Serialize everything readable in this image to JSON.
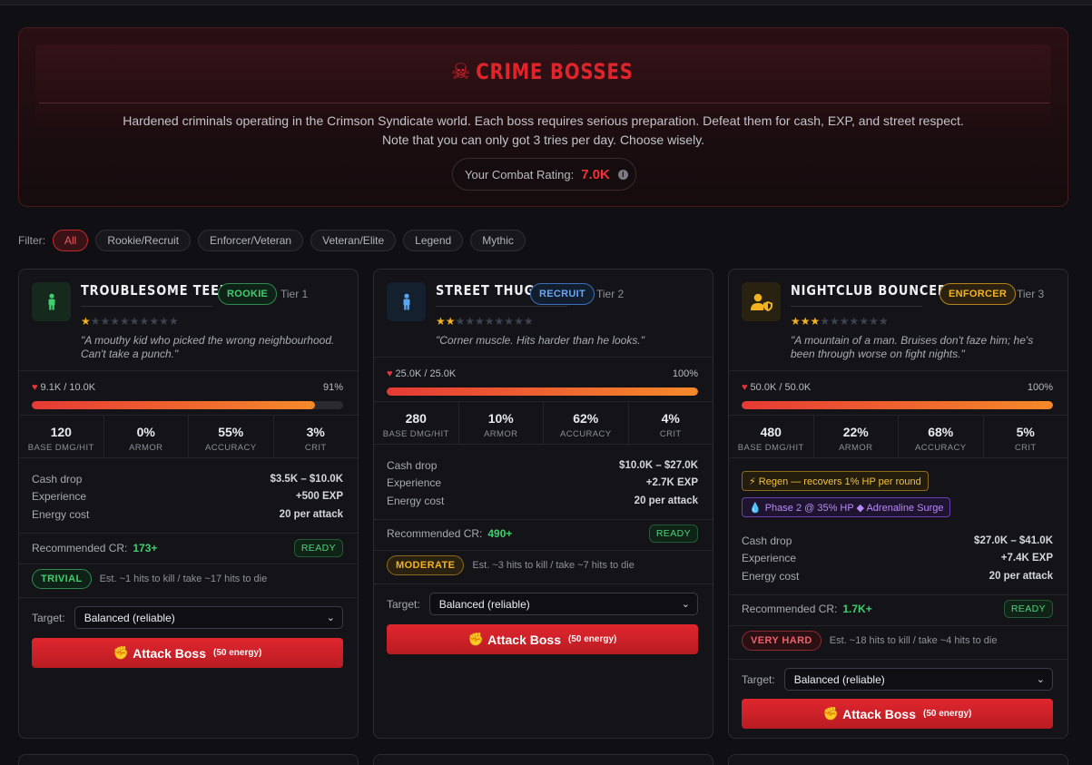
{
  "header": {
    "title": "CRIME BOSSES",
    "title_icon": "skull-crossbones-icon",
    "description_line1": "Hardened criminals operating in the Crimson Syndicate world. Each boss requires serious preparation. Defeat them for cash, EXP, and street respect.",
    "description_line2": "Note that you can only got 3 tries per day. Choose wisely.",
    "combat_rating_label": "Your Combat Rating:",
    "combat_rating_value": "7.0K",
    "info_icon": "info-icon"
  },
  "filters": {
    "label": "Filter:",
    "options": [
      "All",
      "Rookie/Recruit",
      "Enforcer/Veteran",
      "Veteran/Elite",
      "Legend",
      "Mythic"
    ],
    "active": "All"
  },
  "labels": {
    "base_dmg": "BASE DMG/HIT",
    "armor": "ARMOR",
    "accuracy": "ACCURACY",
    "crit": "CRIT",
    "cash_drop": "Cash drop",
    "experience": "Experience",
    "energy_cost": "Energy cost",
    "recommended_cr": "Recommended CR:",
    "target": "Target:",
    "attack": "Attack Boss",
    "attack_energy": "(50 energy)"
  },
  "bosses": [
    {
      "name": "TROUBLESOME TEEN",
      "rank": "ROOKIE",
      "tier": "Tier 1",
      "stars": 1,
      "stars_max": 10,
      "quote": "\"A mouthy kid who picked the wrong neighbourhood. Can't take a punch.\"",
      "hp_text": "9.1K / 10.0K",
      "hp_pct_text": "91%",
      "hp_fraction": 0.91,
      "base_dmg": "120",
      "armor": "0%",
      "accuracy": "55%",
      "crit": "3%",
      "cash_drop": "$3.5K – $10.0K",
      "experience": "+500 EXP",
      "energy_cost": "20 per attack",
      "recommended_cr": "173+",
      "status": "READY",
      "difficulty": "TRIVIAL",
      "estimate": "Est. ~1 hits to kill / take ~17 hits to die",
      "target": "Balanced (reliable)",
      "effects": []
    },
    {
      "name": "STREET THUG",
      "rank": "RECRUIT",
      "tier": "Tier 2",
      "stars": 2,
      "stars_max": 10,
      "quote": "\"Corner muscle. Hits harder than he looks.\"",
      "hp_text": "25.0K / 25.0K",
      "hp_pct_text": "100%",
      "hp_fraction": 1.0,
      "base_dmg": "280",
      "armor": "10%",
      "accuracy": "62%",
      "crit": "4%",
      "cash_drop": "$10.0K – $27.0K",
      "experience": "+2.7K EXP",
      "energy_cost": "20 per attack",
      "recommended_cr": "490+",
      "status": "READY",
      "difficulty": "MODERATE",
      "estimate": "Est. ~3 hits to kill / take ~7 hits to die",
      "target": "Balanced (reliable)",
      "effects": []
    },
    {
      "name": "NIGHTCLUB BOUNCER",
      "rank": "ENFORCER",
      "tier": "Tier 3",
      "stars": 3,
      "stars_max": 10,
      "quote": "\"A mountain of a man. Bruises don't faze him; he's been through worse on fight nights.\"",
      "hp_text": "50.0K / 50.0K",
      "hp_pct_text": "100%",
      "hp_fraction": 1.0,
      "base_dmg": "480",
      "armor": "22%",
      "accuracy": "68%",
      "crit": "5%",
      "cash_drop": "$27.0K – $41.0K",
      "experience": "+7.4K EXP",
      "energy_cost": "20 per attack",
      "recommended_cr": "1.7K+",
      "status": "READY",
      "difficulty": "VERY HARD",
      "estimate": "Est. ~18 hits to kill / take ~4 hits to die",
      "target": "Balanced (reliable)",
      "effects": [
        "⚡ Regen — recovers 1% HP per round",
        "Phase 2 @ 35% HP ◆ Adrenaline Surge"
      ]
    }
  ],
  "colors": {
    "accent_red": "#e0242c",
    "rookie": "#3ecf6e",
    "recruit": "#5a9cf0",
    "enforcer": "#f3b320",
    "trivial": "#3ecf6e",
    "moderate": "#f3b320",
    "very_hard": "#f0505a"
  }
}
